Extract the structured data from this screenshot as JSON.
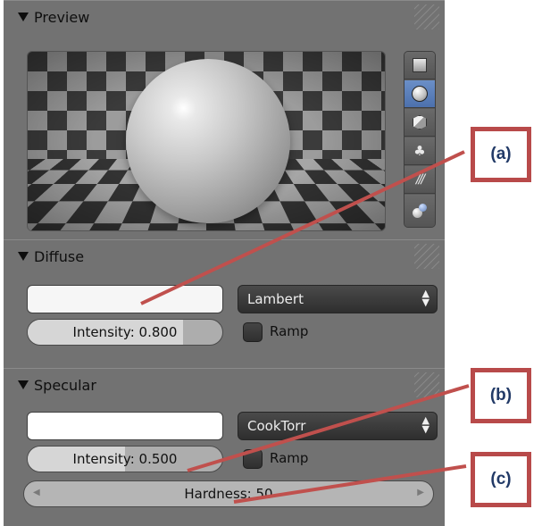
{
  "preview": {
    "title": "Preview",
    "shapes": [
      {
        "icon": "plane-icon",
        "active": false
      },
      {
        "icon": "sphere-icon",
        "active": true
      },
      {
        "icon": "cube-icon",
        "active": false
      },
      {
        "icon": "monkey-icon",
        "active": false
      },
      {
        "icon": "hair-icon",
        "active": false
      },
      {
        "icon": "world-sphere-icon",
        "active": false
      }
    ]
  },
  "diffuse": {
    "title": "Diffuse",
    "shader": "Lambert",
    "intensity_text": "Intensity: 0.800",
    "intensity_value": 0.8,
    "ramp_label": "Ramp",
    "ramp_checked": false
  },
  "specular": {
    "title": "Specular",
    "shader": "CookTorr",
    "intensity_text": "Intensity: 0.500",
    "intensity_value": 0.5,
    "ramp_label": "Ramp",
    "ramp_checked": false,
    "hardness_text": "Hardness: 50"
  },
  "annotations": [
    "(a)",
    "(b)",
    "(c)"
  ],
  "colors": {
    "panel_bg": "#727272",
    "active_blue": "#5a7fbe",
    "callout_border": "#b84a4a",
    "callout_text": "#223a67"
  }
}
